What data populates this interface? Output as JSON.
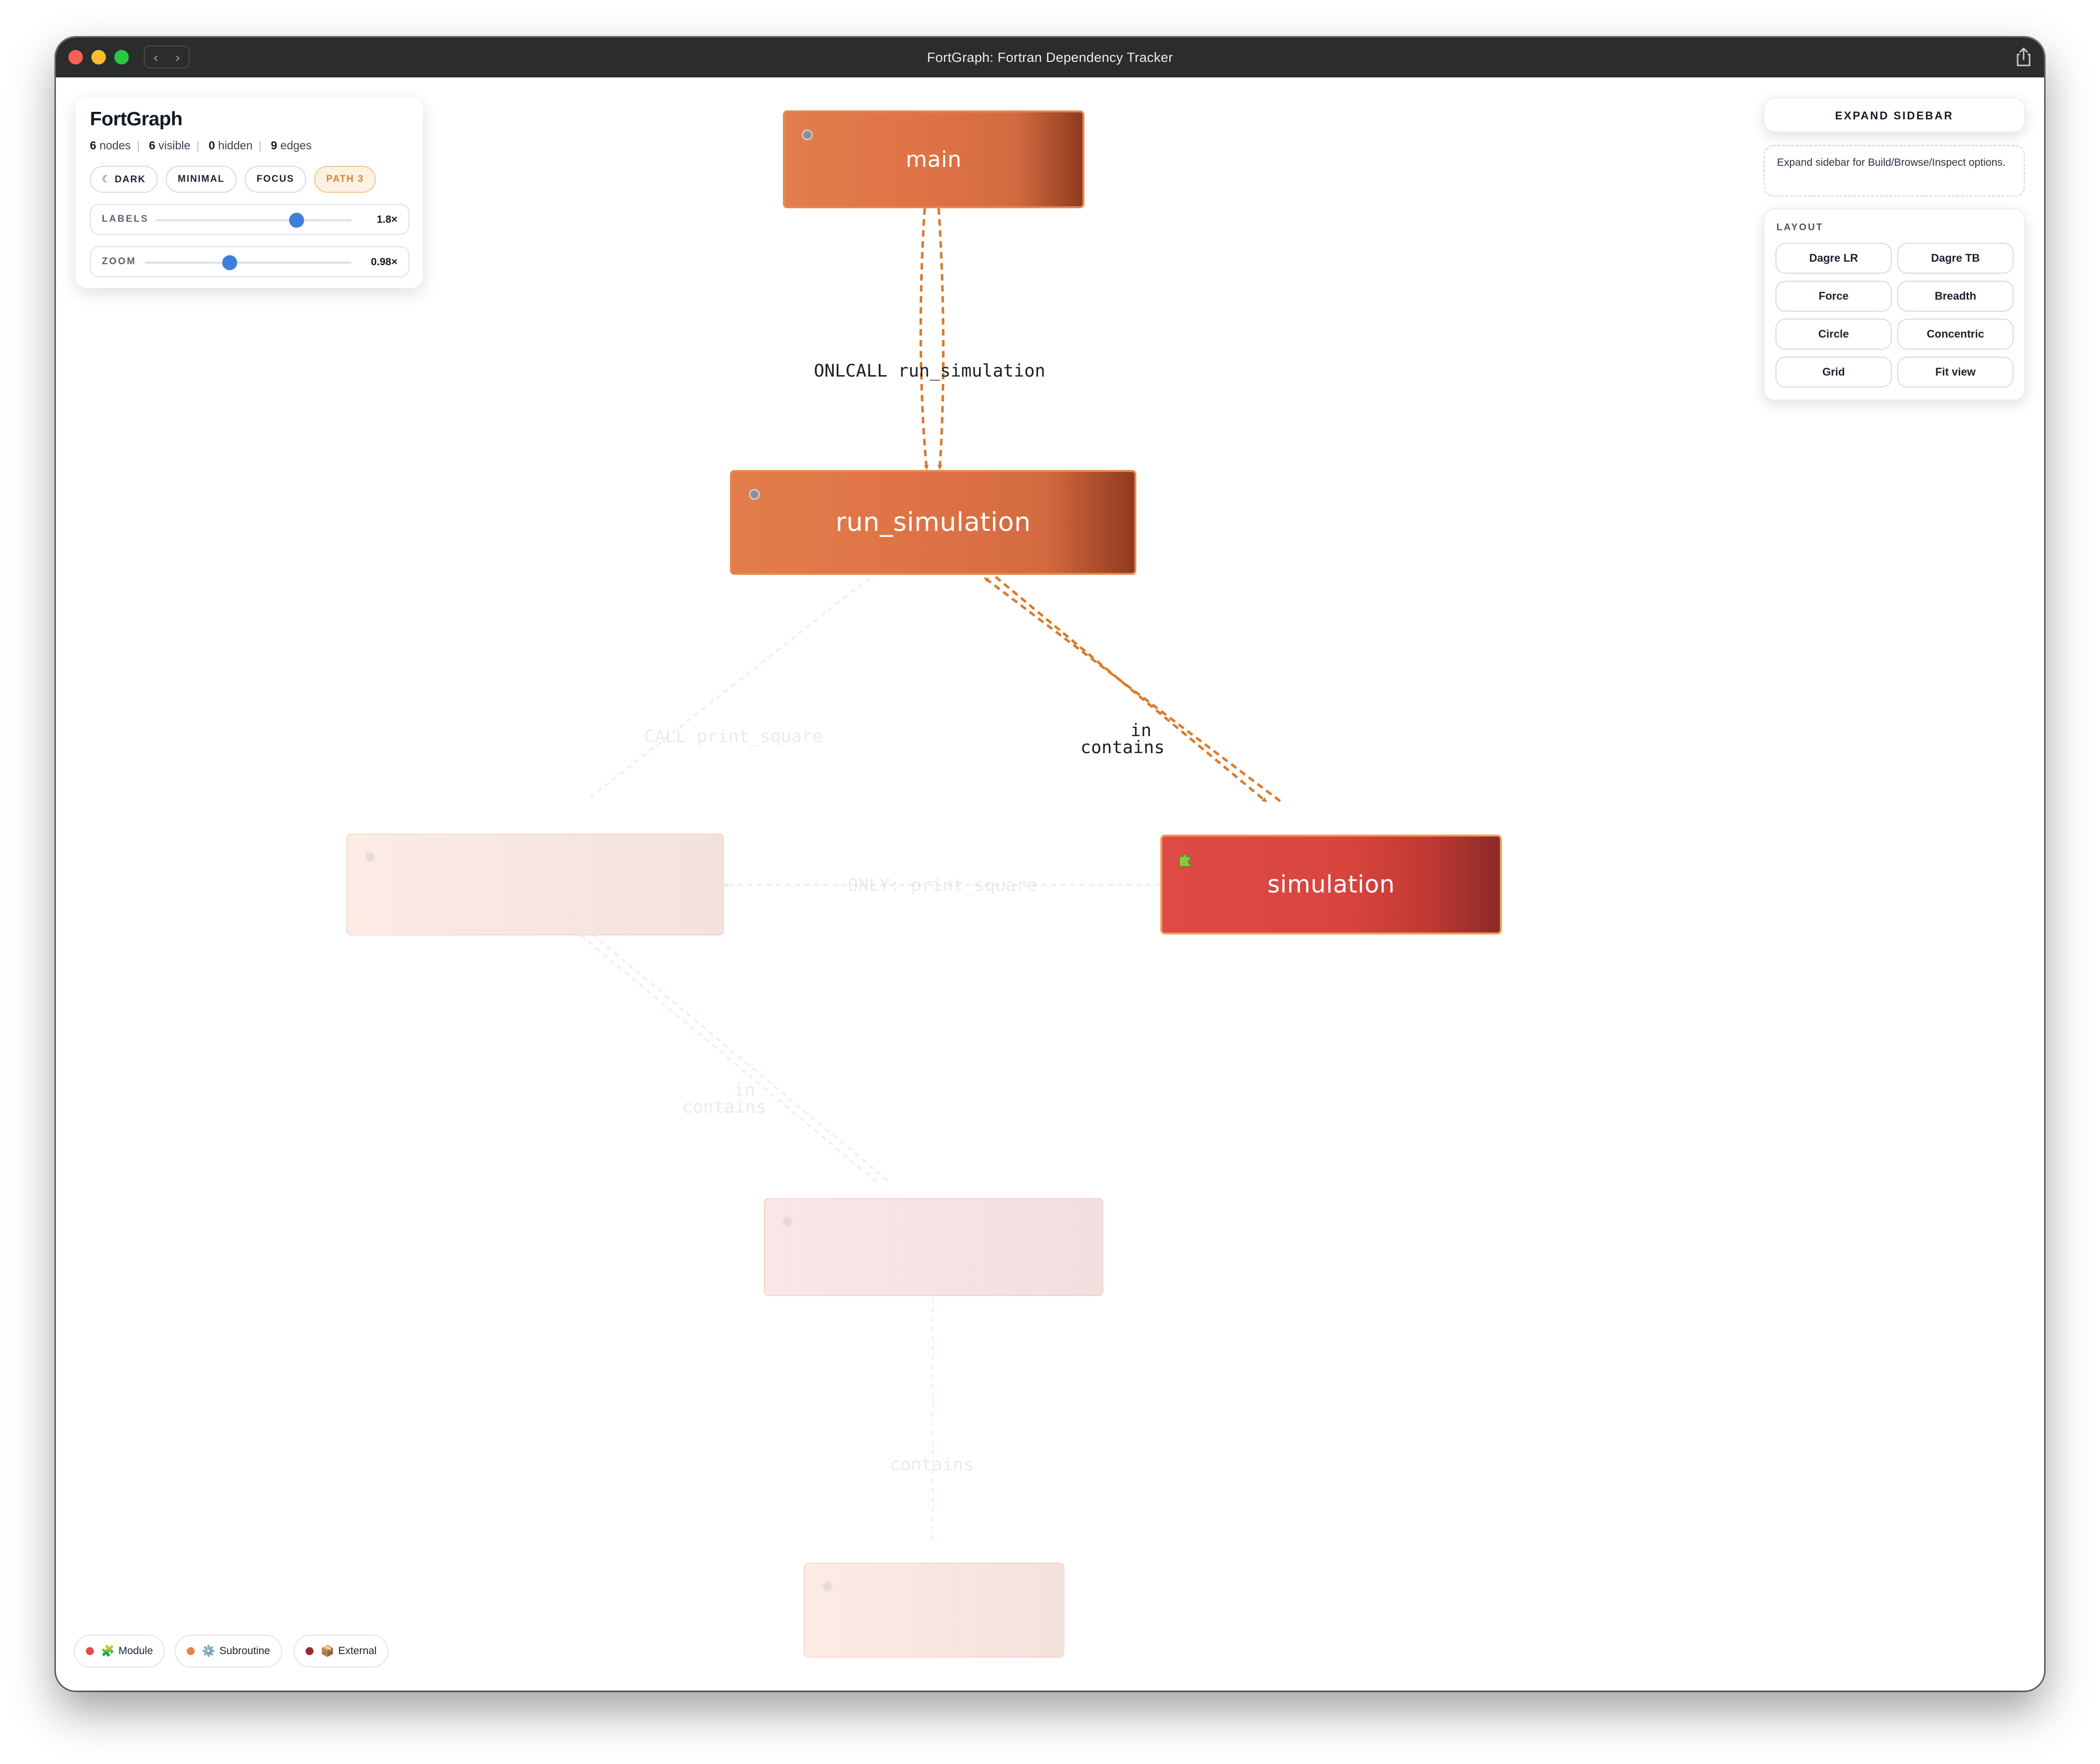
{
  "window": {
    "title": "FortGraph: Fortran Dependency Tracker",
    "back_glyph": "‹",
    "forward_glyph": "›"
  },
  "panel": {
    "title": "FortGraph",
    "stats": {
      "nodes_count": "6",
      "nodes_label": "nodes",
      "visible_count": "6",
      "visible_label": "visible",
      "hidden_count": "0",
      "hidden_label": "hidden",
      "edges_count": "9",
      "edges_label": "edges"
    },
    "chips": {
      "dark": "☾ DARK",
      "minimal": "MINIMAL",
      "focus": "FOCUS",
      "path": "PATH 3"
    },
    "labels_slider": {
      "label": "LABELS",
      "value_text": "1.8×",
      "level": 0.72
    },
    "zoom_slider": {
      "label": "ZOOM",
      "value_text": "0.98×",
      "level": 0.41
    }
  },
  "sidebar": {
    "expand_label": "EXPAND SIDEBAR",
    "hint": "Expand sidebar for Build/Browse/Inspect options.",
    "layout_title": "LAYOUT",
    "layout_buttons": [
      "Dagre LR",
      "Dagre TB",
      "Force",
      "Breadth",
      "Circle",
      "Concentric",
      "Grid",
      "Fit view"
    ]
  },
  "graph": {
    "nodes": {
      "main": {
        "label": "main",
        "kind": "subroutine",
        "icon": "gear-icon"
      },
      "run_simulation": {
        "label": "run_simulation",
        "kind": "subroutine",
        "icon": "gear-icon"
      },
      "simulation": {
        "label": "simulation",
        "kind": "module",
        "icon": "puzzle-icon"
      }
    },
    "edge_labels": {
      "main_run": "ONLCALL run_simulation",
      "run_sim_in": "in",
      "run_sim_contains": "contains",
      "call_print_square": "CALL print_square",
      "only_print_square": "ONLY: print_square",
      "faded_in": "in",
      "faded_contains": "contains",
      "faded_contains_2": "contains"
    }
  },
  "legend": [
    {
      "label": "Module",
      "icon": "puzzle-icon",
      "glyph": "🧩",
      "color": "#e5484d"
    },
    {
      "label": "Subroutine",
      "icon": "gear-icon",
      "glyph": "⚙️",
      "color": "#e8834e"
    },
    {
      "label": "External",
      "icon": "package-icon",
      "glyph": "📦",
      "color": "#9b2c2c"
    }
  ],
  "colors": {
    "subroutine": "#e37d4b",
    "module": "#de4a45",
    "edge_highlight": "#d97a2b",
    "slider_thumb": "#3f7fdc",
    "path_chip": "#d4852d"
  }
}
